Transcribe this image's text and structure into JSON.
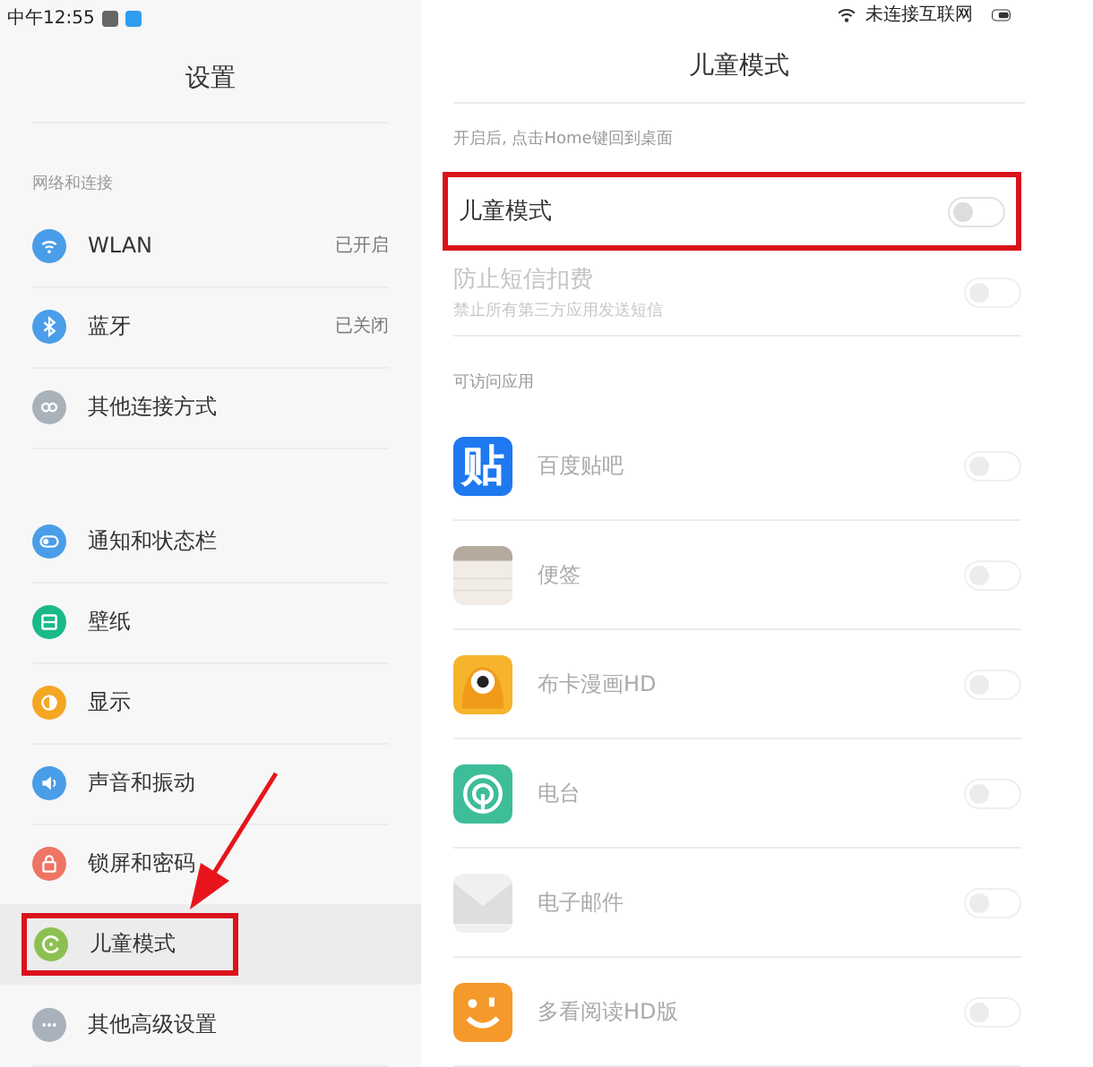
{
  "status_bar": {
    "time": "中午12:55",
    "network": "未连接互联网"
  },
  "settings": {
    "title": "设置",
    "sections": [
      {
        "heading": "网络和连接",
        "items": [
          {
            "kind": "wifi",
            "label": "WLAN",
            "value": "已开启",
            "color": "#4a9de8",
            "selected": false,
            "highlighted": false
          },
          {
            "kind": "bluetooth",
            "label": "蓝牙",
            "value": "已关闭",
            "color": "#4a9de8",
            "selected": false,
            "highlighted": false
          },
          {
            "kind": "link",
            "label": "其他连接方式",
            "color": "#a9b1bb",
            "selected": false,
            "highlighted": false
          }
        ]
      },
      {
        "items": [
          {
            "kind": "notify",
            "label": "通知和状态栏",
            "color": "#4a9de8",
            "selected": false,
            "highlighted": false
          },
          {
            "kind": "wallpaper",
            "label": "壁纸",
            "color": "#19b98a",
            "selected": false,
            "highlighted": false
          },
          {
            "kind": "display",
            "label": "显示",
            "color": "#f5a623",
            "selected": false,
            "highlighted": false
          },
          {
            "kind": "sound",
            "label": "声音和振动",
            "color": "#4a9de8",
            "selected": false,
            "highlighted": false
          },
          {
            "kind": "lock",
            "label": "锁屏和密码",
            "color": "#f07464",
            "selected": false,
            "highlighted": false
          },
          {
            "kind": "child",
            "label": "儿童模式",
            "color": "#8cc152",
            "selected": true,
            "highlighted": true
          },
          {
            "kind": "more",
            "label": "其他高级设置",
            "color": "#a9b1bb",
            "selected": false,
            "highlighted": false
          }
        ]
      }
    ]
  },
  "child_mode": {
    "title": "儿童模式",
    "hint": "开启后, 点击Home键回到桌面",
    "toggles": [
      {
        "label": "儿童模式",
        "on": false,
        "disabled": false,
        "highlighted": true
      },
      {
        "label": "防止短信扣费",
        "subtitle": "禁止所有第三方应用发送短信",
        "on": false,
        "disabled": true,
        "highlighted": false
      }
    ],
    "apps_heading": "可访问应用",
    "apps": [
      {
        "kind": "glyph",
        "icon_text": "贴",
        "label": "百度贴吧",
        "on": false,
        "disabled": true
      },
      {
        "kind": "notepad",
        "label": "便签",
        "on": false,
        "disabled": true
      },
      {
        "kind": "monster",
        "label": "布卡漫画HD",
        "on": false,
        "disabled": true
      },
      {
        "kind": "broadcast",
        "label": "电台",
        "on": false,
        "disabled": true
      },
      {
        "kind": "envelope",
        "label": "电子邮件",
        "on": false,
        "disabled": true
      },
      {
        "kind": "smiley",
        "label": "多看阅读HD版",
        "on": false,
        "disabled": true
      }
    ]
  }
}
